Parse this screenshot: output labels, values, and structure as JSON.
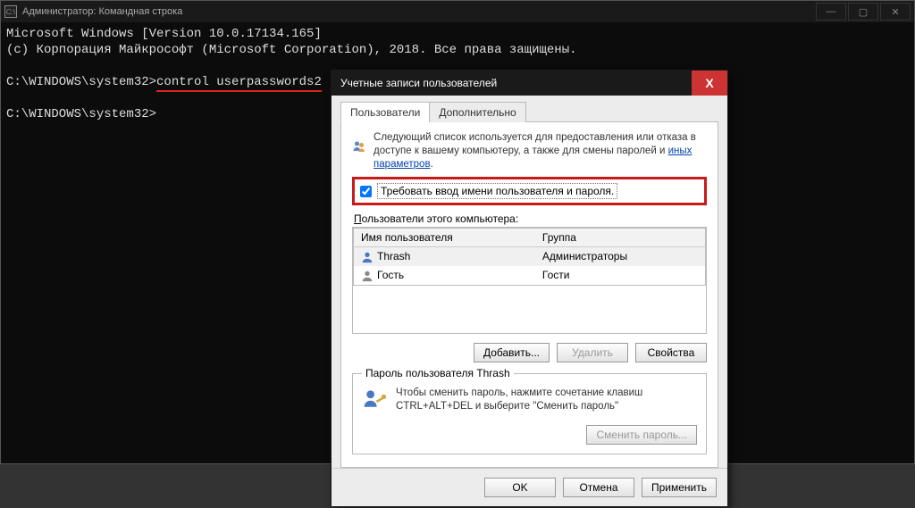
{
  "cmd": {
    "title": "Администратор: Командная строка",
    "icon_text": "C:\\",
    "line1": "Microsoft Windows [Version 10.0.17134.165]",
    "line2": "(c) Корпорация Майкрософт (Microsoft Corporation), 2018. Все права защищены.",
    "prompt1_prefix": "C:\\WINDOWS\\system32>",
    "prompt1_cmd": "control userpasswords2",
    "prompt2": "C:\\WINDOWS\\system32>"
  },
  "dlg": {
    "title": "Учетные записи пользователей",
    "close": "X",
    "tabs": {
      "users": "Пользователи",
      "advanced": "Дополнительно"
    },
    "intro_text": "Следующий список используется для предоставления или отказа в доступе к вашему компьютеру, а также для смены паролей и ",
    "intro_link": "иных параметров",
    "require_checkbox_label": "Требовать ввод имени пользователя и пароля.",
    "list_label_pre": "П",
    "list_label_rest": "ользователи этого компьютера:",
    "table": {
      "col_user": "Имя пользователя",
      "col_group": "Группа",
      "rows": [
        {
          "user": "Thrash",
          "group": "Администраторы"
        },
        {
          "user": "Гость",
          "group": "Гости"
        }
      ]
    },
    "buttons": {
      "add": "Добавить...",
      "remove": "Удалить",
      "props": "Свойства"
    },
    "pw_legend": "Пароль пользователя Thrash",
    "pw_text": "Чтобы сменить пароль, нажмите сочетание клавиш CTRL+ALT+DEL и выберите \"Сменить пароль\"",
    "pw_button": "Сменить пароль...",
    "footer": {
      "ok": "OK",
      "cancel": "Отмена",
      "apply": "Применить"
    }
  }
}
